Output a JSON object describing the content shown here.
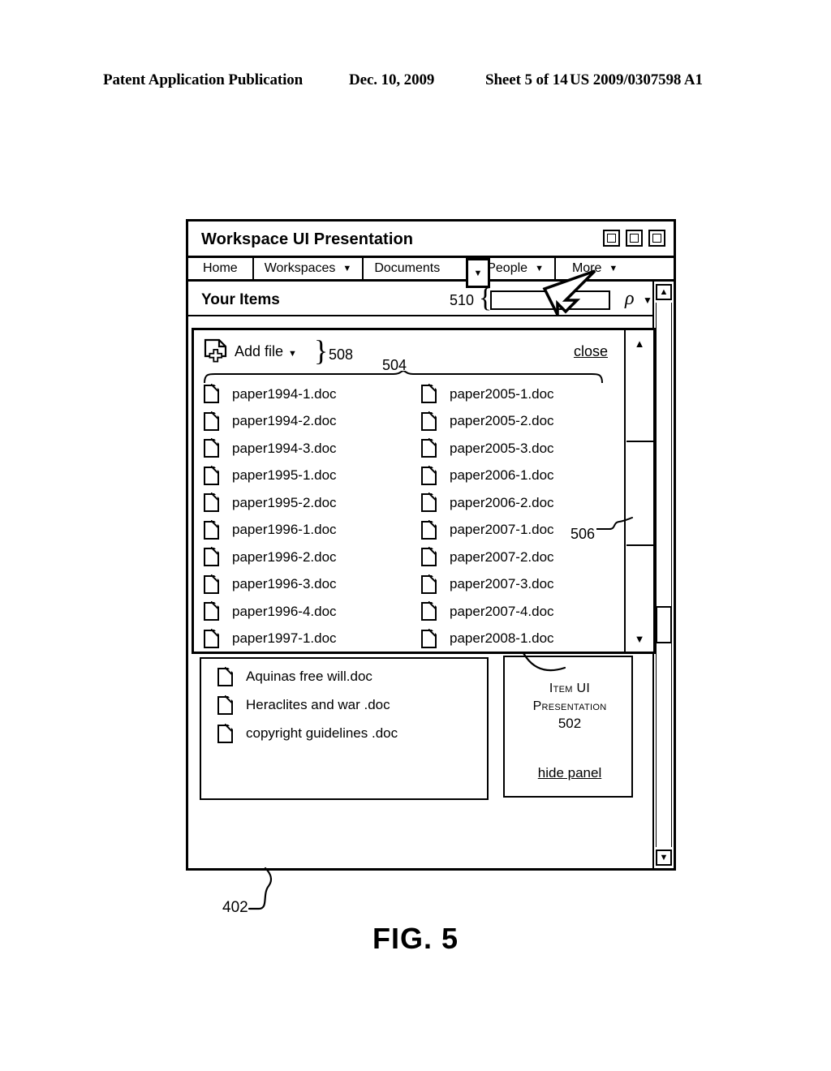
{
  "patent_header": {
    "publication": "Patent Application Publication",
    "date": "Dec. 10, 2009",
    "sheet": "Sheet 5 of 14",
    "number": "US 2009/0307598 A1"
  },
  "figure": {
    "caption": "FIG. 5",
    "ref_window": "402"
  },
  "window": {
    "title": "Workspace UI Presentation",
    "controls": [
      "minimize-box",
      "maximize-box",
      "close-box"
    ]
  },
  "nav_tabs": [
    {
      "label": "Home",
      "has_caret": false
    },
    {
      "label": "Workspaces",
      "has_caret": true
    },
    {
      "label": "Documents",
      "has_caret": false
    },
    {
      "label": "People",
      "has_caret": true
    },
    {
      "label": "More",
      "has_caret": true
    }
  ],
  "documents_dropdown_button": {
    "glyph": "▼",
    "state": "pressed"
  },
  "items_header": {
    "title": "Your Items",
    "ref_search": "510",
    "brace": "{",
    "search_value": "",
    "search_placeholder": "",
    "search_icon": "ρ",
    "search_caret": "▼"
  },
  "dropdown": {
    "ref_panel": "504",
    "ref_addfile": "508",
    "brace_addfile": "}",
    "add_file_label": "Add file",
    "add_file_caret": "▼",
    "close_label": "close",
    "ref_scrollbar": "506",
    "scroll_up": "▲",
    "scroll_down": "▼",
    "files_left": [
      "paper1994-1.doc",
      "paper1994-2.doc",
      "paper1994-3.doc",
      "paper1995-1.doc",
      "paper1995-2.doc",
      "paper1996-1.doc",
      "paper1996-2.doc",
      "paper1996-3.doc",
      "paper1996-4.doc",
      "paper1997-1.doc"
    ],
    "files_right": [
      "paper2005-1.doc",
      "paper2005-2.doc",
      "paper2005-3.doc",
      "paper2006-1.doc",
      "paper2006-2.doc",
      "paper2007-1.doc",
      "paper2007-2.doc",
      "paper2007-3.doc",
      "paper2007-4.doc",
      "paper2008-1.doc"
    ]
  },
  "background_files": [
    "Aquinas free will.doc",
    "Heraclites and war .doc",
    "copyright guidelines .doc"
  ],
  "item_panel": {
    "title_line1": "Item UI",
    "title_line2": "Presentation",
    "ref": "502",
    "hide_label": "hide panel"
  },
  "outer_scrollbar": {
    "up": "▲",
    "down": "▼"
  },
  "colors": {
    "ink": "#000000",
    "paper": "#ffffff"
  }
}
